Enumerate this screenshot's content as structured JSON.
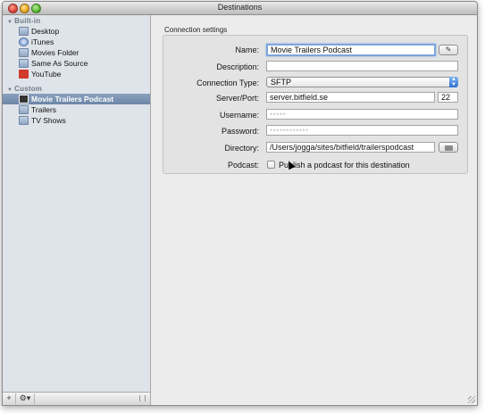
{
  "window": {
    "title": "Destinations"
  },
  "sidebar": {
    "builtin_header": "Built-in",
    "builtin_items": [
      {
        "label": "Desktop",
        "icon": "folder-icon"
      },
      {
        "label": "iTunes",
        "icon": "itunes-icon"
      },
      {
        "label": "Movies Folder",
        "icon": "folder-icon"
      },
      {
        "label": "Same As Source",
        "icon": "folder-icon"
      },
      {
        "label": "YouTube",
        "icon": "youtube-icon"
      }
    ],
    "custom_header": "Custom",
    "custom_items": [
      {
        "label": "Movie Trailers Podcast",
        "icon": "film-icon",
        "selected": true
      },
      {
        "label": "Trailers",
        "icon": "folder-icon"
      },
      {
        "label": "TV Shows",
        "icon": "folder-icon"
      }
    ],
    "footer": {
      "add_label": "+",
      "gear_label": "⚙▾"
    }
  },
  "settings": {
    "group_title": "Connection settings",
    "name_label": "Name:",
    "name_value": "Movie Trailers Podcast",
    "description_label": "Description:",
    "description_value": "",
    "connection_type_label": "Connection Type:",
    "connection_type_value": "SFTP",
    "server_port_label": "Server/Port:",
    "server_value": "server.bitfield.se",
    "port_value": "22",
    "username_label": "Username:",
    "username_value": "•••••",
    "password_label": "Password:",
    "password_value": "••••••••••••",
    "directory_label": "Directory:",
    "directory_value": "/Users/jogga/sites/bitfield/trailerspodcast",
    "podcast_label": "Podcast:",
    "podcast_checkbox_label": "Publish a podcast for this destination",
    "podcast_checked": false
  }
}
